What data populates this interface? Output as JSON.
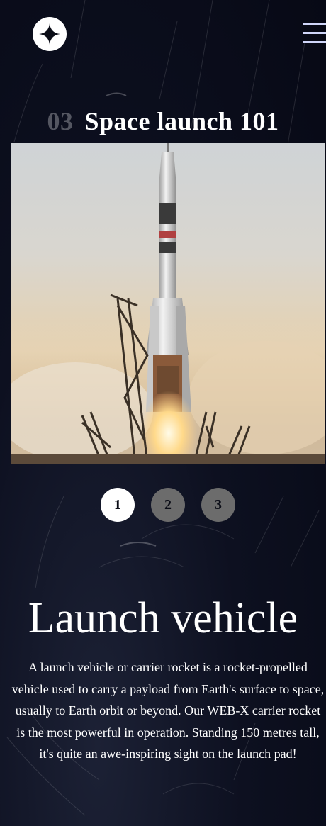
{
  "header": {
    "logo_icon": "star-four-point-icon",
    "menu_icon": "hamburger-menu-icon"
  },
  "subheading": {
    "number": "03",
    "text": "Space launch 101"
  },
  "hero": {
    "image": "rocket-launch-photo"
  },
  "pager": {
    "items": [
      "1",
      "2",
      "3"
    ],
    "active": "1"
  },
  "content": {
    "title": "Launch vehicle",
    "description": "A launch vehicle or carrier rocket is a rocket-propelled vehicle used to carry a payload from Earth's surface to space, usually to Earth orbit or beyond. Our WEB-X carrier rocket is the most powerful in operation. Standing 150 metres tall, it's quite an awe-inspiring sight on the launch pad!"
  },
  "colors": {
    "background": "#0b0d17",
    "accent": "#d0d6f9",
    "inactive_dot": "#6c6c6c",
    "text": "#ffffff"
  }
}
